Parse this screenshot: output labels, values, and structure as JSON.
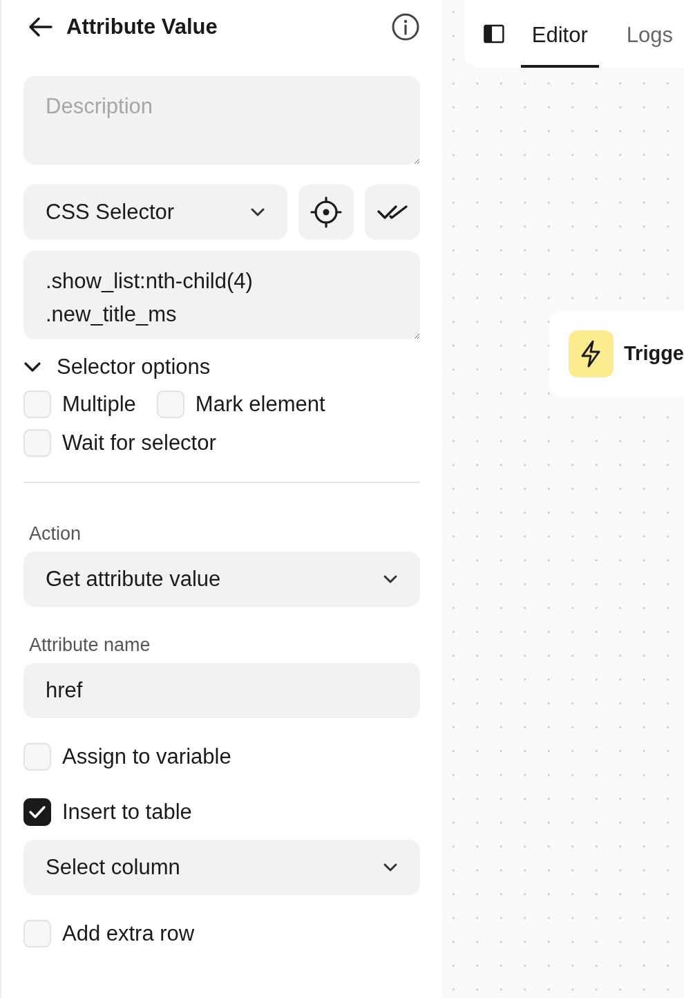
{
  "header": {
    "title": "Attribute Value"
  },
  "description": {
    "placeholder": "Description"
  },
  "selector_type": {
    "value": "CSS Selector"
  },
  "selector": {
    "value": ".show_list:nth-child(4)\n.new_title_ms"
  },
  "selector_options": {
    "label": "Selector options",
    "expanded": true,
    "rows": [
      [
        {
          "label": "Multiple",
          "checked": false
        },
        {
          "label": "Mark element",
          "checked": false
        }
      ],
      [
        {
          "label": "Wait for selector",
          "checked": false
        }
      ]
    ]
  },
  "action": {
    "label": "Action",
    "value": "Get attribute value"
  },
  "attribute_name": {
    "label": "Attribute name",
    "value": "href"
  },
  "assign_to_variable": {
    "label": "Assign to variable",
    "checked": false
  },
  "insert_to_table": {
    "label": "Insert to table",
    "checked": true
  },
  "column_select": {
    "value": "Select column"
  },
  "add_extra_row": {
    "label": "Add extra row",
    "checked": false
  },
  "tabs": [
    {
      "label": "Editor",
      "selected": true
    },
    {
      "label": "Logs",
      "selected": false
    }
  ],
  "node": {
    "label": "Trigge"
  }
}
